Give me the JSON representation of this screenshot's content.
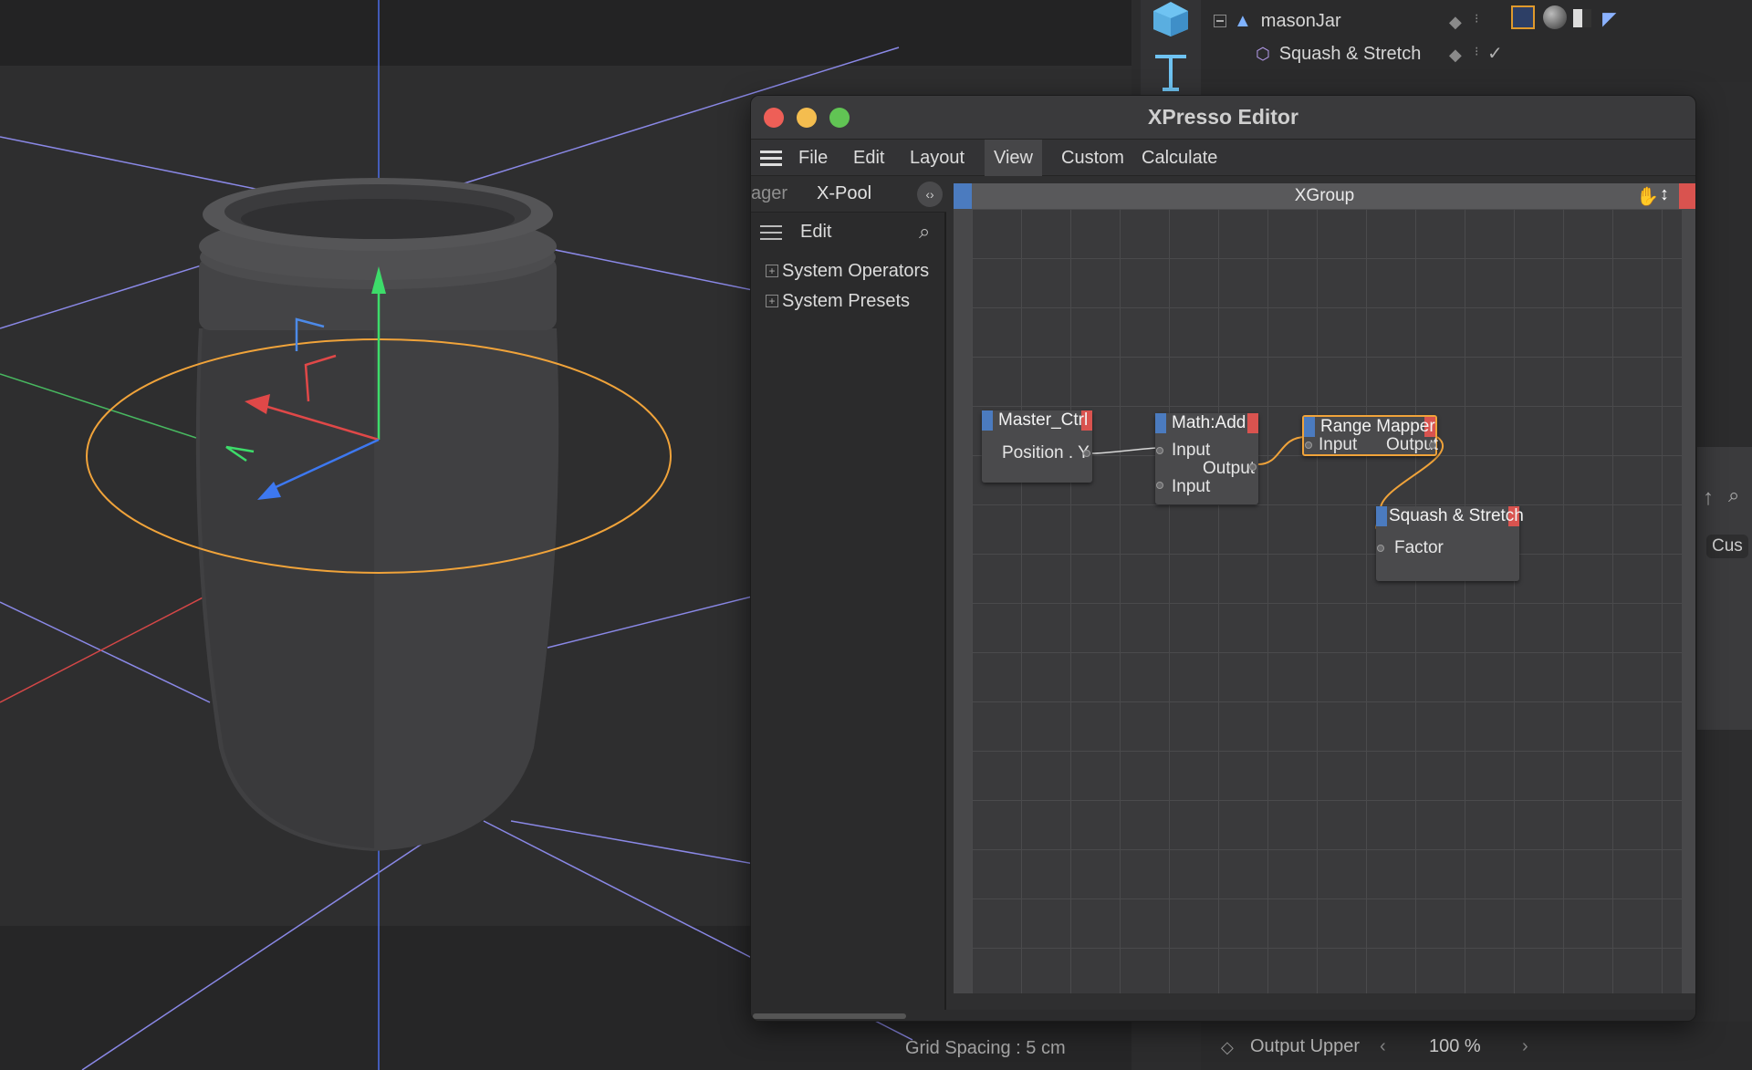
{
  "window": {
    "title": "XPresso Editor"
  },
  "menu": [
    "File",
    "Edit",
    "Layout",
    "View",
    "Custom",
    "Calculate"
  ],
  "left_tabs": [
    "ager",
    "X-Pool"
  ],
  "left_edit_label": "Edit",
  "tree_items": [
    "System Operators",
    "System Presets"
  ],
  "xgroup_title": "XGroup",
  "nodes": {
    "master": {
      "title": "Master_Ctrl",
      "port": "Position . Y"
    },
    "math": {
      "title": "Math:Add",
      "in1": "Input",
      "out": "Output",
      "in2": "Input"
    },
    "range": {
      "title": "Range Mapper",
      "in": "Input",
      "out": "Output"
    },
    "squash": {
      "title": "Squash & Stretch",
      "port": "Factor"
    }
  },
  "outliner": {
    "row1": "masonJar",
    "row2": "Squash & Stretch"
  },
  "viewport": {
    "grid_spacing": "Grid Spacing : 5 cm"
  },
  "attributes": {
    "label": "Output Upper",
    "value": "100 %"
  },
  "side_label": "Cus",
  "colors": {
    "accent_orange": "#f0a33a",
    "port_blue": "#4b7bbf",
    "port_red": "#d9534f"
  }
}
